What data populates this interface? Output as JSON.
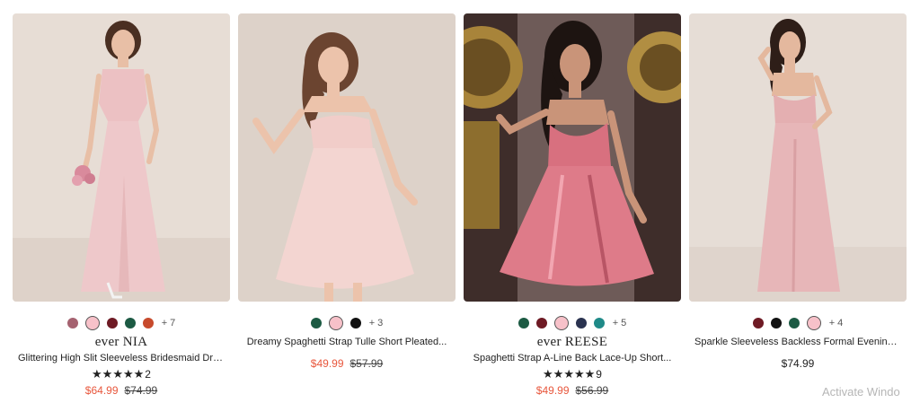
{
  "products": [
    {
      "swatches": [
        "#a56270",
        "#f7c1c9",
        "#6e1a24",
        "#1c5a43",
        "#c74a2c"
      ],
      "selected_swatch": 1,
      "more_colors": "+ 7",
      "brand": "ever NIA",
      "title": "Glittering High Slit Sleeveless Bridesmaid Dress...",
      "stars": "★★★★★",
      "reviews": "2",
      "sale_price": "$64.99",
      "regular_price": "$74.99",
      "photo_colors": {
        "bg": "#e7ddd5",
        "dress": "#ecc1c3",
        "hair": "#4a2f22",
        "skin": "#e8bfa6"
      }
    },
    {
      "swatches": [
        "#1c5a43",
        "#f7c1c9",
        "#111111"
      ],
      "selected_swatch": 1,
      "more_colors": "+ 3",
      "brand": "",
      "title": "Dreamy Spaghetti Strap Tulle Short Pleated...",
      "stars": "",
      "reviews": "",
      "sale_price": "$49.99",
      "regular_price": "$57.99",
      "photo_colors": {
        "bg": "#ddd2c9",
        "dress": "#f1cdc9",
        "hair": "#6b4430",
        "skin": "#ecc3ab"
      }
    },
    {
      "swatches": [
        "#1c5a43",
        "#6e1a24",
        "#f7c1c9",
        "#2a3350",
        "#1f8a88"
      ],
      "selected_swatch": 2,
      "more_colors": "+ 5",
      "brand": "ever REESE",
      "title": "Spaghetti Strap A-Line Back Lace-Up Short...",
      "stars": "★★★★★",
      "reviews": "9",
      "sale_price": "$49.99",
      "regular_price": "$56.99",
      "photo_colors": {
        "bg": "#3e2d2a",
        "dress": "#d8707f",
        "hair": "#1d1411",
        "skin": "#c99479"
      }
    },
    {
      "swatches": [
        "#6e1a24",
        "#111111",
        "#1c5a43",
        "#f7c1c9"
      ],
      "selected_swatch": 3,
      "more_colors": "+ 4",
      "brand": "",
      "title": "Sparkle Sleeveless Backless Formal Evening Dre...",
      "stars": "",
      "reviews": "",
      "sale_price": "",
      "regular_price": "$74.99",
      "photo_colors": {
        "bg": "#e6ddd6",
        "dress": "#e4afb1",
        "hair": "#2e1e18",
        "skin": "#e4b89e"
      }
    }
  ],
  "watermark": "Activate Windo"
}
